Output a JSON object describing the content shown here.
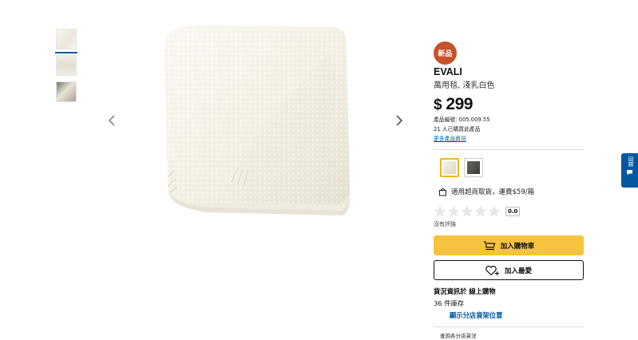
{
  "gallery": {
    "thumbnails": [
      {
        "name": "blanket-folded-thumbnail"
      },
      {
        "name": "blanket-stack-thumbnail"
      },
      {
        "name": "blanket-room-thumbnail"
      }
    ],
    "active_index": 0
  },
  "product": {
    "badge": "新品",
    "name": "EVALI",
    "description": "萬用毯, 淺乳白色",
    "price_currency": "$",
    "price_value": "299",
    "article_number": "產品編號: 005.009.55",
    "purchase_count": "21 人已購買此產品",
    "more_info_link": "更多產品資訊"
  },
  "variants": [
    {
      "color": "#efeadd",
      "selected": true
    },
    {
      "color": "#4a4641",
      "selected": false
    }
  ],
  "delivery": {
    "pickup_text": "適用超商取貨，運費$59/箱"
  },
  "rating": {
    "stars": 0,
    "max_stars": 5,
    "score": "0.0",
    "reviews_text": "沒有評論"
  },
  "actions": {
    "add_to_cart": "加入購物車",
    "add_to_favorites": "加入最愛"
  },
  "stock": {
    "title": "貨況資訊於 線上購物",
    "count": "36 件庫存",
    "store_location_link": "顯示分店貨架位置",
    "store_query": "查詢各分店貨況"
  },
  "feedback_tab": {
    "label": "回饋"
  },
  "colors": {
    "accent_blue": "#0058a3",
    "cart_yellow": "#f6c33f",
    "new_badge": "#c4522a"
  }
}
